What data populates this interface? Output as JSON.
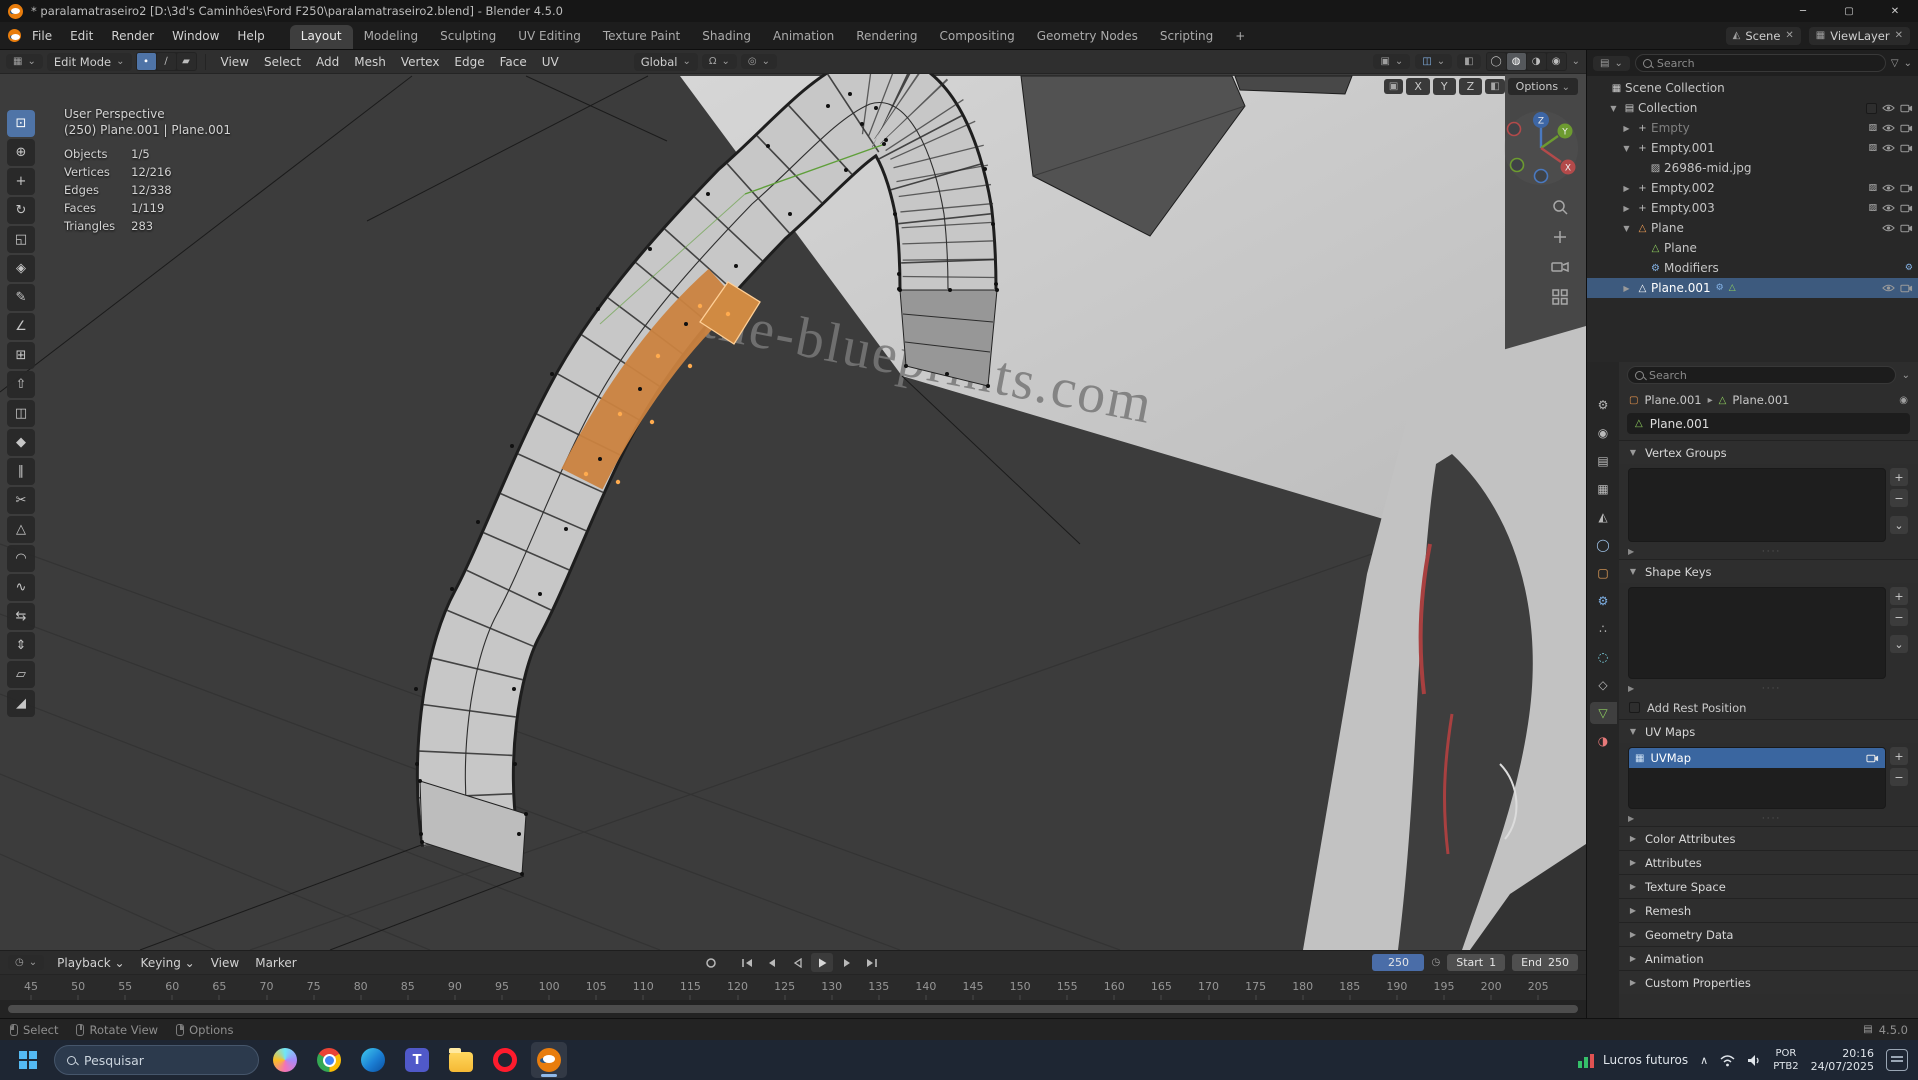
{
  "colors": {
    "accent_blue": "#4772b3",
    "selection_orange": "#e8923c",
    "viewport_bg": "#3c3c3c",
    "panel_bg": "#2d2d2d",
    "outliner_selected": "#3d5a7e",
    "uvmap_selected": "#3a66a0",
    "taskbar_bg": "#1e2633"
  },
  "title_bar": {
    "title": "* paralamatraseiro2 [D:\\3d's Caminhões\\Ford F250\\paralamatraseiro2.blend] - Blender 4.5.0",
    "minimize": "─",
    "maximize": "▢",
    "close": "✕"
  },
  "menu_bar": {
    "menus": [
      "File",
      "Edit",
      "Render",
      "Window",
      "Help"
    ],
    "workspaces": [
      "Layout",
      "Modeling",
      "Sculpting",
      "UV Editing",
      "Texture Paint",
      "Shading",
      "Animation",
      "Rendering",
      "Compositing",
      "Geometry Nodes",
      "Scripting"
    ],
    "active_workspace": "Layout",
    "add_workspace": "+",
    "scene": "Scene",
    "view_layer": "ViewLayer"
  },
  "viewport_header": {
    "mode": "Edit Mode",
    "select_modes": [
      "vertex",
      "edge",
      "face"
    ],
    "active_select_mode": "vertex",
    "menus": [
      "View",
      "Select",
      "Add",
      "Mesh",
      "Vertex",
      "Edge",
      "Face",
      "UV"
    ],
    "orientation": "Global",
    "transform_overlay": {
      "axes": [
        "X",
        "Y",
        "Z"
      ],
      "options": "Options"
    }
  },
  "toolbar_tools": [
    "select-box",
    "cursor",
    "move",
    "rotate",
    "scale",
    "transform",
    "annotate",
    "measure",
    "add-cube",
    "extrude-region",
    "inset-faces",
    "bevel",
    "loop-cut",
    "knife",
    "poly-build",
    "spin",
    "smooth",
    "edge-slide",
    "shrink-fatten",
    "shear",
    "rip-region"
  ],
  "viewport": {
    "overlay": {
      "view_name": "User Perspective",
      "context": "(250) Plane.001 | Plane.001",
      "stats": [
        {
          "label": "Objects",
          "value": "1/5"
        },
        {
          "label": "Vertices",
          "value": "12/216"
        },
        {
          "label": "Edges",
          "value": "12/338"
        },
        {
          "label": "Faces",
          "value": "1/119"
        },
        {
          "label": "Triangles",
          "value": "283"
        }
      ]
    },
    "watermark_main": "the-blueprints.com",
    "watermark_fragment": ".com",
    "gizmo_axes": [
      "X",
      "Y",
      "Z"
    ]
  },
  "outliner": {
    "search_placeholder": "Search",
    "items": [
      {
        "label": "Scene Collection",
        "indent": 0,
        "icon": "scene-collection",
        "expand": "none",
        "right": []
      },
      {
        "label": "Collection",
        "indent": 1,
        "icon": "collection",
        "expand": "open",
        "right": [
          "checkbox",
          "eye",
          "camera"
        ]
      },
      {
        "label": "Empty",
        "indent": 2,
        "icon": "empty",
        "expand": "closed",
        "dimmed": true,
        "right": [
          "image",
          "eye",
          "camera"
        ]
      },
      {
        "label": "Empty.001",
        "indent": 2,
        "icon": "empty",
        "expand": "open",
        "right": [
          "image",
          "eye",
          "camera"
        ]
      },
      {
        "label": "26986-mid.jpg",
        "indent": 3,
        "icon": "image",
        "expand": "none",
        "right": []
      },
      {
        "label": "Empty.002",
        "indent": 2,
        "icon": "empty",
        "expand": "closed",
        "right": [
          "image",
          "eye",
          "camera"
        ]
      },
      {
        "label": "Empty.003",
        "indent": 2,
        "icon": "empty",
        "expand": "closed",
        "right": [
          "image",
          "eye",
          "camera"
        ]
      },
      {
        "label": "Plane",
        "indent": 2,
        "icon": "mesh-object",
        "expand": "open",
        "right": [
          "eye",
          "camera"
        ]
      },
      {
        "label": "Plane",
        "indent": 3,
        "icon": "mesh-data",
        "expand": "none",
        "right": []
      },
      {
        "label": "Modifiers",
        "indent": 3,
        "icon": "modifiers",
        "expand": "none",
        "right": [
          "modifiers"
        ]
      },
      {
        "label": "Plane.001",
        "indent": 2,
        "icon": "mesh-object",
        "expand": "closed",
        "selected": true,
        "badges": [
          "modifiers",
          "mesh-data"
        ],
        "right": [
          "eye",
          "camera"
        ]
      }
    ]
  },
  "properties": {
    "search_placeholder": "Search",
    "breadcrumb": [
      "Plane.001",
      "Plane.001"
    ],
    "name_field": "Plane.001",
    "tabs": [
      "tool",
      "render",
      "output",
      "view-layer",
      "scene",
      "world",
      "object",
      "modifiers",
      "particles",
      "physics",
      "constraints",
      "object-data",
      "material"
    ],
    "active_tab": "object-data",
    "panels": [
      {
        "label": "Vertex Groups",
        "type": "list",
        "items": []
      },
      {
        "label": "Shape Keys",
        "type": "list",
        "items": []
      },
      {
        "label": "Add Rest Position",
        "type": "checkbox",
        "checked": false
      },
      {
        "label": "UV Maps",
        "type": "list",
        "items": [
          {
            "name": "UVMap",
            "selected": true
          }
        ]
      },
      {
        "label": "Color Attributes",
        "type": "collapsed"
      },
      {
        "label": "Attributes",
        "type": "collapsed"
      },
      {
        "label": "Texture Space",
        "type": "collapsed"
      },
      {
        "label": "Remesh",
        "type": "collapsed"
      },
      {
        "label": "Geometry Data",
        "type": "collapsed"
      },
      {
        "label": "Animation",
        "type": "collapsed"
      },
      {
        "label": "Custom Properties",
        "type": "collapsed"
      }
    ]
  },
  "timeline": {
    "menus": [
      "Playback",
      "Keying",
      "View",
      "Marker"
    ],
    "current_frame": "250",
    "start_label": "Start",
    "start": "1",
    "end_label": "End",
    "end": "250",
    "ruler_ticks": [
      "45",
      "50",
      "55",
      "60",
      "65",
      "70",
      "75",
      "80",
      "85",
      "90",
      "95",
      "100",
      "105",
      "110",
      "115",
      "120",
      "125",
      "130",
      "135",
      "140",
      "145",
      "150",
      "155",
      "160",
      "165",
      "170",
      "175",
      "180",
      "185",
      "190",
      "195",
      "200",
      "205"
    ]
  },
  "status_bar": {
    "hints": [
      "Select",
      "Rotate View",
      "Options"
    ],
    "version": "4.5.0"
  },
  "taskbar": {
    "search_placeholder": "Pesquisar",
    "apps": [
      "copilot",
      "chrome",
      "edge",
      "teams",
      "file-explorer",
      "opera",
      "blender"
    ],
    "active_app": "blender",
    "widget": "Lucros futuros",
    "lang_top": "POR",
    "lang_bottom": "PTB2",
    "time": "20:16",
    "date": "24/07/2025"
  }
}
